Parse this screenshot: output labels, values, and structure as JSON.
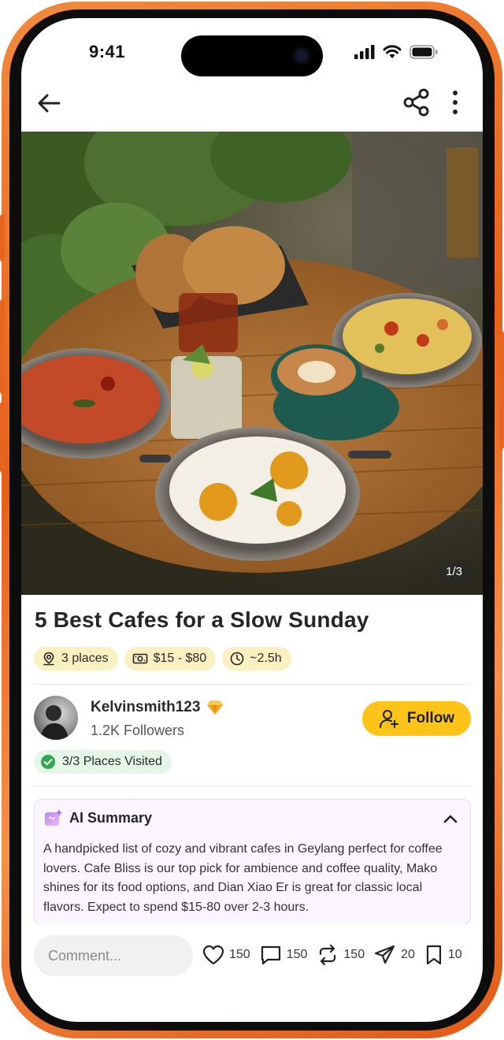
{
  "status_bar": {
    "time": "9:41"
  },
  "hero": {
    "image_counter": "1/3",
    "image_description": "Round wooden table with breakfast pans, latte, iced lemon drink, tea and bread"
  },
  "post": {
    "title": "5 Best Cafes for a Slow Sunday",
    "chips": [
      {
        "icon": "map-pin-icon",
        "label": "3 places"
      },
      {
        "icon": "cash-icon",
        "label": "$15 - $80"
      },
      {
        "icon": "clock-icon",
        "label": "~2.5h"
      }
    ]
  },
  "author": {
    "username": "Kelvinsmith123",
    "badge_icon": "diamond-badge-icon",
    "followers": "1.2K Followers",
    "follow_label": "Follow",
    "visited": "3/3 Places Visited"
  },
  "ai_summary": {
    "title": "AI Summary",
    "text": "A handpicked list of cozy and vibrant cafes in Geylang perfect for coffee lovers. Cafe Bliss is our top pick for ambience and coffee quality, Mako shines for its food options, and Dian Xiao Er is great for classic local flavors. Expect to spend $15-80 over 2-3 hours."
  },
  "bottom_bar": {
    "comment_placeholder": "Comment...",
    "actions": [
      {
        "icon": "heart-icon",
        "count": "150"
      },
      {
        "icon": "comment-icon",
        "count": "150"
      },
      {
        "icon": "repost-icon",
        "count": "150"
      },
      {
        "icon": "send-icon",
        "count": "20"
      },
      {
        "icon": "bookmark-icon",
        "count": "10"
      }
    ]
  },
  "colors": {
    "frame_orange": "#e8651f",
    "follow_yellow": "#fcc419",
    "chip_bg": "#fbf0c2",
    "visited_bg": "#e4f6e6",
    "ai_card_bg": "#faf5ff"
  }
}
